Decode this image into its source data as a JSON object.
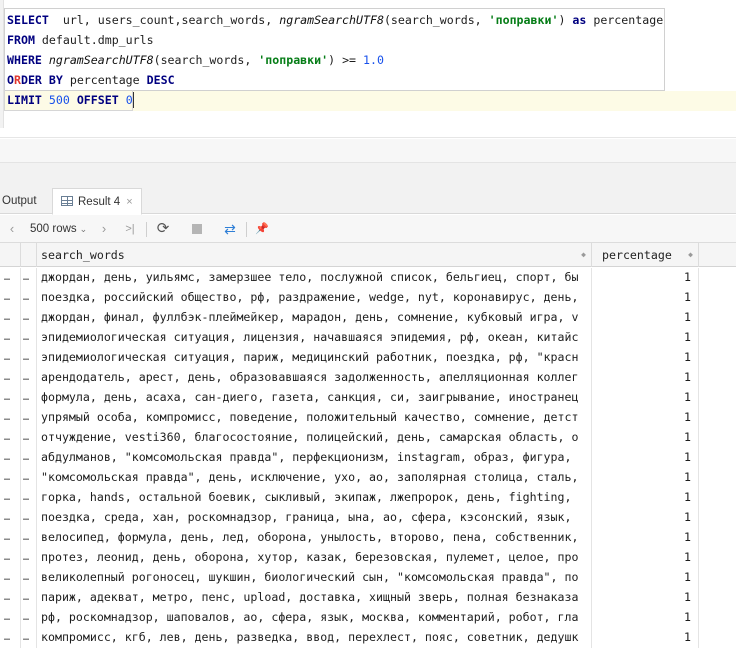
{
  "editor": {
    "line1": {
      "kw1": "SELECT",
      "cols": "  url, users_count,search_words, ",
      "fn": "ngramSearchUTF8",
      "args": "(search_words, ",
      "str": "'поправки'",
      "tail": ") ",
      "kw2": "as",
      "alias": " percentage"
    },
    "line2": {
      "kw": "FROM",
      "rest": " default.dmp_urls"
    },
    "line3": {
      "kw": "WHERE",
      "sp": " ",
      "fn": "ngramSearchUTF8",
      "args": "(search_words, ",
      "str": "'поправки'",
      "op": ") >= ",
      "num": "1.0"
    },
    "line4": {
      "kw_a": "O",
      "marker": "R",
      "kw_b": "DER BY",
      "rest": " percentage ",
      "kw2": "DESC"
    },
    "line5": {
      "kw": "LIMIT",
      "sp1": " ",
      "n1": "500",
      "sp2": " ",
      "kw2": "OFFSET",
      "sp3": " ",
      "n2": "0"
    }
  },
  "tabs": {
    "output_label": "Output",
    "result_label": "Result 4",
    "close_glyph": "×"
  },
  "toolbar": {
    "prev": "‹",
    "rows_label": "500 rows",
    "rows_dropdown": "⌄",
    "next": "›",
    "last": ">|",
    "refresh": "⟳",
    "compare": "⇄",
    "pin": "📌"
  },
  "grid": {
    "columns": [
      "search_words",
      "percentage"
    ],
    "sort_glyph": "◆",
    "row_marker": "…",
    "rows": [
      {
        "search_words": "джордан, день, уильямс, замерзшее тело, послужной список, бельгиец, спорт, бы",
        "percentage": "1"
      },
      {
        "search_words": "поездка, российский общество, рф, раздражение, wedge, nyt, коронавирус, день,",
        "percentage": "1"
      },
      {
        "search_words": "джордан, финал, фуллбэк-плеймейкер, марадон, день, сомнение, кубковый игра, v",
        "percentage": "1"
      },
      {
        "search_words": "эпидемиологическая ситуация, лицензия, начавшаяся эпидемия, рф, океан, китайс",
        "percentage": "1"
      },
      {
        "search_words": "эпидемиологическая ситуация, париж, медицинский работник, поездка, рф, \"красн",
        "percentage": "1"
      },
      {
        "search_words": "арендодатель, арест, день, образовавшаяся задолженность, апелляционная коллег",
        "percentage": "1"
      },
      {
        "search_words": "формула, день, асаха, сан-диего, газета, санкция, си, заигрывание, иностранец",
        "percentage": "1"
      },
      {
        "search_words": "упрямый особа, компромисс, поведение, положительный качество, сомнение, детст",
        "percentage": "1"
      },
      {
        "search_words": "отчуждение, vesti360, благосостояние, полицейский, день, самарская область, о",
        "percentage": "1"
      },
      {
        "search_words": "абдулманов, \"комсомольская правда\", перфекционизм, instagram, образ, фигура,",
        "percentage": "1"
      },
      {
        "search_words": "\"комсомольская правда\", день, исключение, ухо, ао, заполярная столица, сталь,",
        "percentage": "1"
      },
      {
        "search_words": "горка, hands, остальной боевик, сыкливый, экипаж, лжепророк, день, fighting,",
        "percentage": "1"
      },
      {
        "search_words": "поездка, среда, хан, роскомнадзор, граница, ына, ао, сфера, кэсонский, язык,",
        "percentage": "1"
      },
      {
        "search_words": "велосипед, формула, день, лед, оборона, унылость, второво, пена, собственник,",
        "percentage": "1"
      },
      {
        "search_words": "протез, леонид, день, оборона, хутор, казак, березовская, пулемет, целое, про",
        "percentage": "1"
      },
      {
        "search_words": "великолепный рогоносец, шукшин, биологический сын, \"комсомольская правда\", по",
        "percentage": "1"
      },
      {
        "search_words": "париж, адекват, метро, пенс, upload, доставка, хищный зверь, полная безнаказа",
        "percentage": "1"
      },
      {
        "search_words": "рф, роскомнадзор, шаповалов, ао, сфера, язык, москва, комментарий, робот, гла",
        "percentage": "1"
      },
      {
        "search_words": "компромисс, кгб, лев, день, разведка, ввод, перехлест, пояс, советник, дедушк",
        "percentage": "1"
      }
    ]
  }
}
